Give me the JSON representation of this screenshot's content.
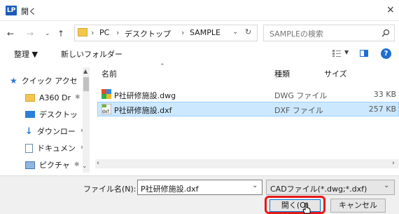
{
  "window": {
    "title": "開く",
    "logo_text": "LP",
    "close": "×"
  },
  "address": {
    "crumbs": [
      "PC",
      "デスクトップ",
      "SAMPLE"
    ],
    "separator": "›",
    "search_placeholder": "SAMPLEの検索"
  },
  "toolbar": {
    "organize": "整理 ▼",
    "new_folder": "新しいフォルダー"
  },
  "sidebar": {
    "items": [
      {
        "label": "クイック アクセ",
        "icon": "star-icon"
      },
      {
        "label": "A360 Dr",
        "icon": "folder-icon"
      },
      {
        "label": "デスクトッ",
        "icon": "desktop-icon"
      },
      {
        "label": "ダウンロー",
        "icon": "download-icon"
      },
      {
        "label": "ドキュメン",
        "icon": "document-icon"
      },
      {
        "label": "ピクチャ",
        "icon": "picture-icon"
      }
    ]
  },
  "file_list": {
    "columns": {
      "name": "名前",
      "type": "種類",
      "size": "サイズ"
    },
    "rows": [
      {
        "name": "P社研修施設.dwg",
        "type": "DWG ファイル",
        "size": "33 KB",
        "selected": false
      },
      {
        "name": "P社研修施設.dxf",
        "type": "DXF ファイル",
        "size": "257 KB",
        "selected": true
      }
    ]
  },
  "footer": {
    "filename_label": "ファイル名(N):",
    "filename_value": "P社研修施設.dxf",
    "filter_value": "CADファイル(*.dwg;*.dxf)",
    "open_label": "開く(O)",
    "cancel_label": "キャンセル"
  },
  "colors": {
    "accent": "#0078d7",
    "selection": "#cce8ff",
    "highlight_ring": "#e81818"
  }
}
